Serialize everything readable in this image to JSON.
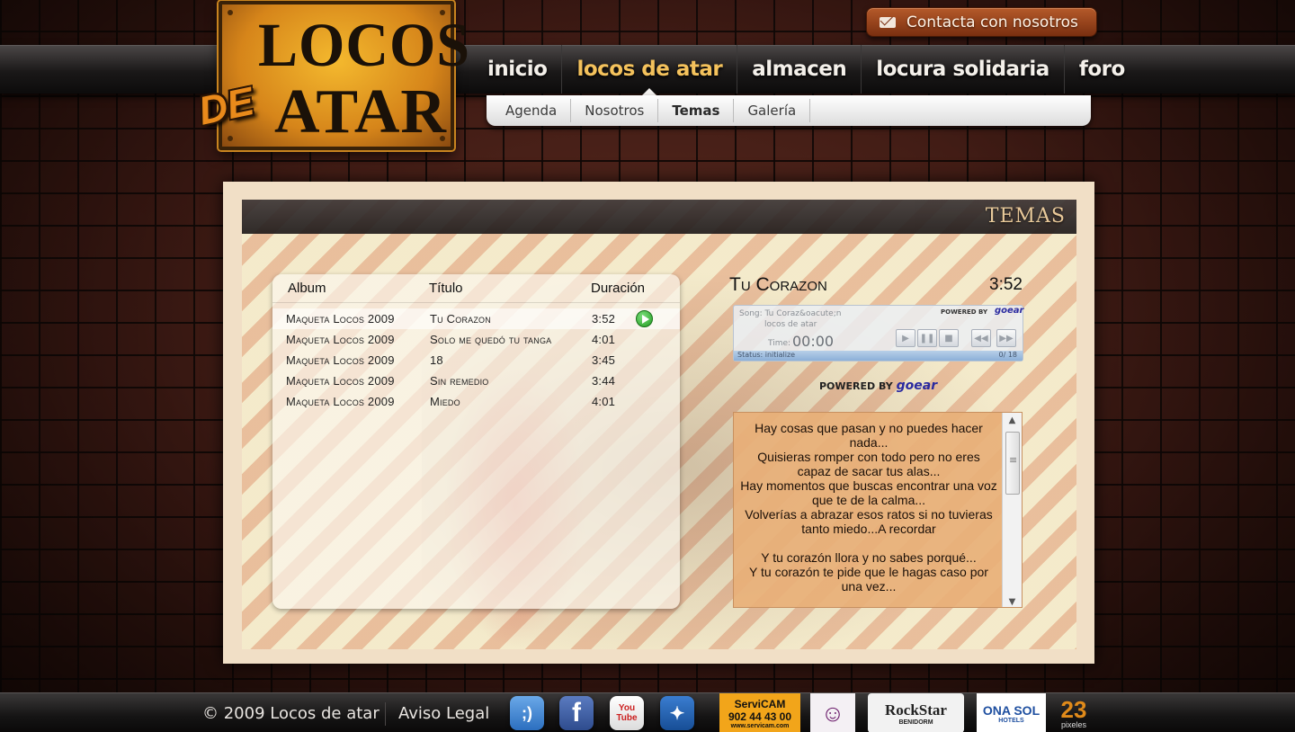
{
  "logo": {
    "line1": "LOCOS",
    "line2": "ATAR",
    "de": "DE"
  },
  "contact": {
    "label": "Contacta con nosotros",
    "icon": "mail-icon"
  },
  "nav": {
    "items": [
      {
        "label": "inicio"
      },
      {
        "label": "locos de atar"
      },
      {
        "label": "almacen"
      },
      {
        "label": "locura solidaria"
      },
      {
        "label": "foro"
      }
    ],
    "active": "locos de atar"
  },
  "subnav": {
    "items": [
      {
        "label": "Agenda"
      },
      {
        "label": "Nosotros"
      },
      {
        "label": "Temas"
      },
      {
        "label": "Galería"
      }
    ],
    "active": "Temas"
  },
  "section": {
    "title": "TEMAS"
  },
  "playlist": {
    "headers": {
      "album": "Album",
      "title": "Título",
      "duration": "Duración"
    },
    "rows": [
      {
        "album": "Maqueta Locos 2009",
        "title": "Tu Corazon",
        "duration": "3:52"
      },
      {
        "album": "Maqueta Locos 2009",
        "title": "Solo me quedó tu tanga",
        "duration": "4:01"
      },
      {
        "album": "Maqueta Locos 2009",
        "title": "18",
        "duration": "3:45"
      },
      {
        "album": "Maqueta Locos 2009",
        "title": "Sin remedio",
        "duration": "3:44"
      },
      {
        "album": "Maqueta Locos 2009",
        "title": "Miedo",
        "duration": "4:01"
      }
    ]
  },
  "now_playing": {
    "title": "Tu Corazon",
    "time": "3:52",
    "player": {
      "song": "Song: Tu Coraz&oacute;n",
      "artist": "locos de atar",
      "powered": "POWERED BY",
      "brand": "goear",
      "time_label": "Time:",
      "time_value": "00:00",
      "status": "Status: initialize",
      "count": "0/ 18"
    },
    "powered_by": "POWERED BY",
    "powered_brand": "goear"
  },
  "lyrics": {
    "lines": [
      "Hay cosas que pasan y no puedes hacer nada...",
      "Quisieras romper con todo pero no eres capaz de sacar tus alas...",
      "Hay momentos que buscas encontrar una voz que te de la calma...",
      "Volverías a abrazar esos ratos si no tuvieras tanto miedo...A recordar",
      "",
      "Y tu corazón llora y no sabes porqué...",
      "Y tu corazón te pide que le hagas caso por una vez..."
    ]
  },
  "footer": {
    "copyright": "© 2009  Locos de atar",
    "legal": "Aviso Legal",
    "social": [
      {
        "name": "tuenti",
        "glyph": ";)",
        "color": "#4a8fd6"
      },
      {
        "name": "facebook",
        "glyph": "f",
        "color": "#3b5b98"
      },
      {
        "name": "youtube",
        "glyph": "You Tube",
        "color": "#cc2020"
      },
      {
        "name": "myspace",
        "glyph": "✦",
        "color": "#1a5ea8"
      }
    ],
    "sponsors": [
      {
        "name": "ServiCAM",
        "text": "902 44 43 00",
        "sub": "www.servicam.com"
      },
      {
        "name": "mask",
        "text": ""
      },
      {
        "name": "RockStar",
        "text": "RockStar",
        "sub": "BENIDORM"
      },
      {
        "name": "onasol",
        "text": "ONA SOL",
        "sub": "HOTELS"
      },
      {
        "name": "23pixeles",
        "text": "23",
        "sub": "pixeles"
      }
    ]
  }
}
